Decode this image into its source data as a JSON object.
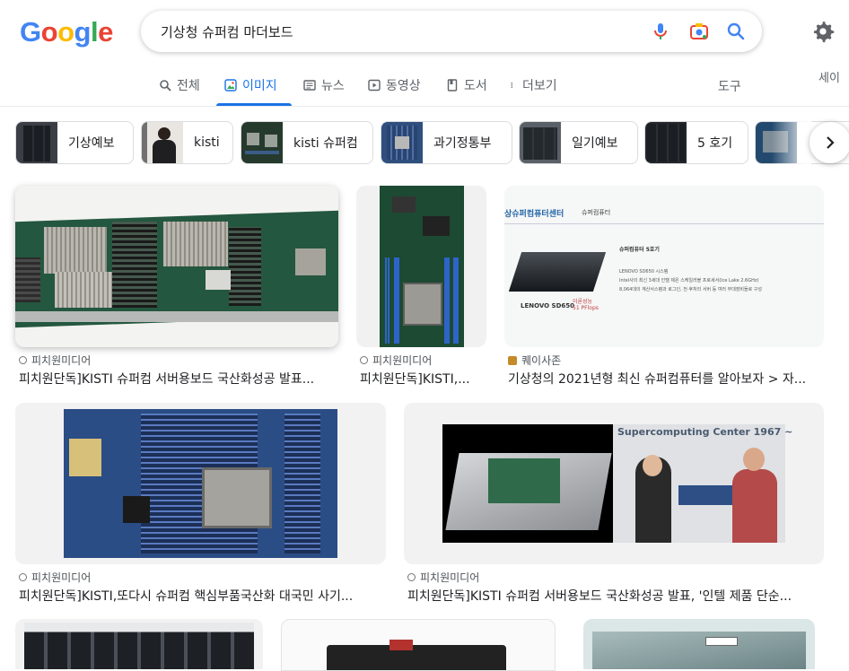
{
  "header": {
    "logo_letters": [
      "G",
      "o",
      "o",
      "g",
      "l",
      "e"
    ],
    "logo_colors": [
      "#4285F4",
      "#EA4335",
      "#FBBC05",
      "#4285F4",
      "#34A853",
      "#EA4335"
    ],
    "query": "기상청 슈퍼컴 마더보드",
    "safesearch": "세이"
  },
  "tabs": [
    {
      "label": "전체",
      "icon": "search-icon",
      "active": false
    },
    {
      "label": "이미지",
      "icon": "image-icon",
      "active": true
    },
    {
      "label": "뉴스",
      "icon": "news-icon",
      "active": false
    },
    {
      "label": "동영상",
      "icon": "play-icon",
      "active": false
    },
    {
      "label": "도서",
      "icon": "book-icon",
      "active": false
    },
    {
      "label": "더보기",
      "icon": "more-vert-icon",
      "active": false
    }
  ],
  "tools_label": "도구",
  "chips": [
    "기상예보",
    "kisti",
    "kisti 슈퍼컴",
    "과기정통부",
    "일기예보",
    "5 호기",
    ""
  ],
  "results": [
    {
      "source": "피치원미디어",
      "title": "피치원단독]KISTI 슈퍼컴 서버용보드 국산화성공 발표..."
    },
    {
      "source": "피치원미디어",
      "title": "피치원단독]KISTI,..."
    },
    {
      "source": "퀘이사존",
      "title": "기상청의 2021년형 최신 슈퍼컴퓨터를 알아보자 > 자..."
    },
    {
      "source": "피치원미디어",
      "title": "피치원단독]KISTI,또다시 슈퍼컴 핵심부품국산화 대국민 사기..."
    },
    {
      "source": "피치원미디어",
      "title": "피치원단독]KISTI 슈퍼컴 서버용보드 국산화성공 발표, '인텔 제품 단순..."
    }
  ],
  "image_text": {
    "slide_title": "상슈퍼컴퓨터센터",
    "slide_sub": "슈퍼컴퓨터",
    "slide_head": "슈퍼컴퓨터 5호기",
    "slide_lines": [
      "LENOVO SD650 시스템",
      "Intel사의 최신 3세대 인텔 제온 스케일러블 프로세서(Ice Lake 2.6GHz)",
      "8,064대의 계산서스템과 로그인, 전·후처리 서버 등 여러 부대장비들로 구성"
    ],
    "slide_model": "LENOVO SD650",
    "slide_perf": "이론성능\n51 PFlops",
    "banner_text": "Supercomputing Center 1967 ~"
  },
  "colors": {
    "accent": "#1a73e8",
    "text": "#202124",
    "muted": "#5f6368",
    "pcb_green": "#1f4a34",
    "pcb_blue": "#2a4e8a"
  }
}
